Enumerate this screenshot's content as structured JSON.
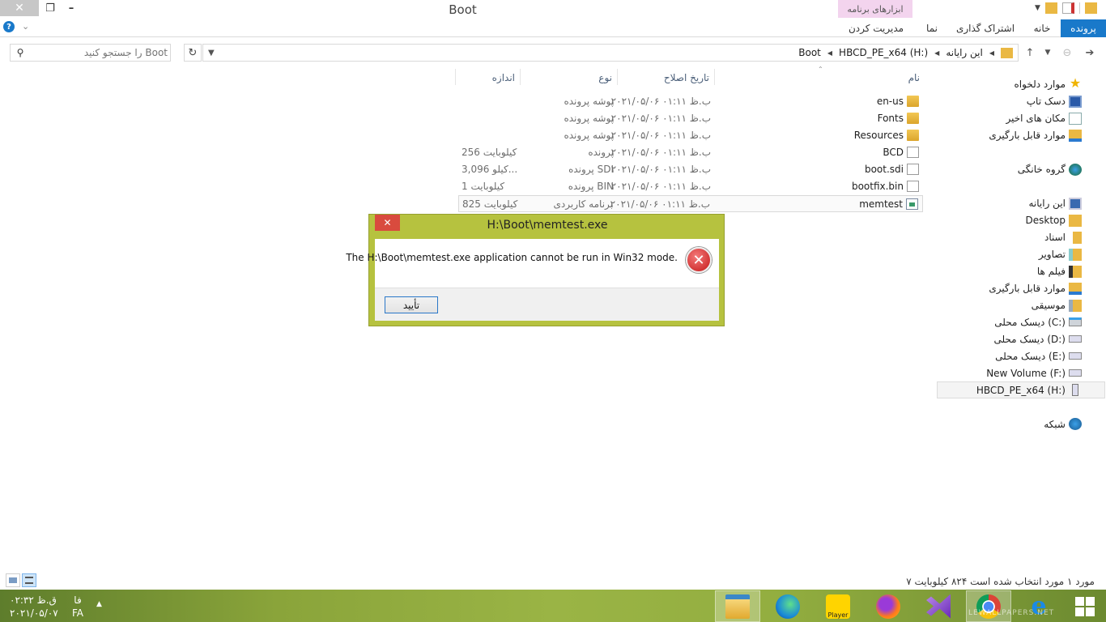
{
  "window": {
    "title": "Boot",
    "tool_tab": "ابزارهای برنامه"
  },
  "ribbon": {
    "tabs": [
      "پرونده",
      "خانه",
      "اشتراک گذاری",
      "نما",
      "مدیریت کردن"
    ]
  },
  "search": {
    "placeholder": "Boot را جستجو کنید"
  },
  "breadcrumb": [
    "Boot",
    "HBCD_PE_x64 (H:)",
    "این رایانه"
  ],
  "columns": {
    "name": "نام",
    "date": "تاریخ اصلاح",
    "type": "نوع",
    "size": "اندازه"
  },
  "files": [
    {
      "name": "en-us",
      "date": "۲۰۲۱/۰۵/۰۶ ب.ظ ۰۱:۱۱",
      "type": "پوشه پرونده",
      "size": "",
      "icon": "folder-icon"
    },
    {
      "name": "Fonts",
      "date": "۲۰۲۱/۰۵/۰۶ ب.ظ ۰۱:۱۱",
      "type": "پوشه پرونده",
      "size": "",
      "icon": "folder-icon"
    },
    {
      "name": "Resources",
      "date": "۲۰۲۱/۰۵/۰۶ ب.ظ ۰۱:۱۱",
      "type": "پوشه پرونده",
      "size": "",
      "icon": "folder-icon"
    },
    {
      "name": "BCD",
      "date": "۲۰۲۱/۰۵/۰۶ ب.ظ ۰۱:۱۱",
      "type": "پرونده",
      "size": "کیلوبایت 256",
      "icon": "file-icon"
    },
    {
      "name": "boot.sdi",
      "date": "۲۰۲۱/۰۵/۰۶ ب.ظ ۰۱:۱۱",
      "type": "پرونده SDI",
      "size": "3,096 کیلو...",
      "icon": "file-icon"
    },
    {
      "name": "bootfix.bin",
      "date": "۲۰۲۱/۰۵/۰۶ ب.ظ ۰۱:۱۱",
      "type": "پرونده BIN",
      "size": "کیلوبایت 1",
      "icon": "file-icon"
    },
    {
      "name": "memtest",
      "date": "۲۰۲۱/۰۵/۰۶ ب.ظ ۰۱:۱۱",
      "type": "برنامه کاربردی",
      "size": "کیلوبایت 825",
      "icon": "application-icon"
    }
  ],
  "nav": {
    "favorites": [
      "موارد دلخواه",
      "دسک تاپ",
      "مکان های اخیر",
      "موارد قابل بارگیری"
    ],
    "homegroup": "گروه خانگی",
    "this_pc": [
      "این رایانه",
      "Desktop",
      "اسناد",
      "تصاویر",
      "فیلم ها",
      "موارد قابل بارگیری",
      "موسیقی",
      "دیسک محلی (C:)",
      "دیسک محلی (D:)",
      "دیسک محلی (E:)",
      "New Volume (F:)",
      "HBCD_PE_x64 (H:)"
    ],
    "network": "شبکه"
  },
  "dialog": {
    "title": "H:\\Boot\\memtest.exe",
    "message": "The H:\\Boot\\memtest.exe application cannot be run in Win32 mode.",
    "ok_label": "تأیید"
  },
  "status": {
    "text": "۷ مورد   ۱ مورد انتخاب شده است  ۸۲۴ کیلوبایت"
  },
  "taskbar": {
    "time": "۰۲:۳۲ ق.ظ",
    "date": "۲۰۲۱/۰۵/۰۷",
    "lang_top": "فا",
    "lang_bottom": "FA",
    "player_label": "Player",
    "watermark": "LEWALLPAPERS.NET"
  },
  "colors": {
    "ribbon_accent": "#1979ca",
    "tool_tab": "#f3d4ee",
    "dialog_frame": "#b6c23f",
    "dialog_close": "#d94b3e"
  }
}
